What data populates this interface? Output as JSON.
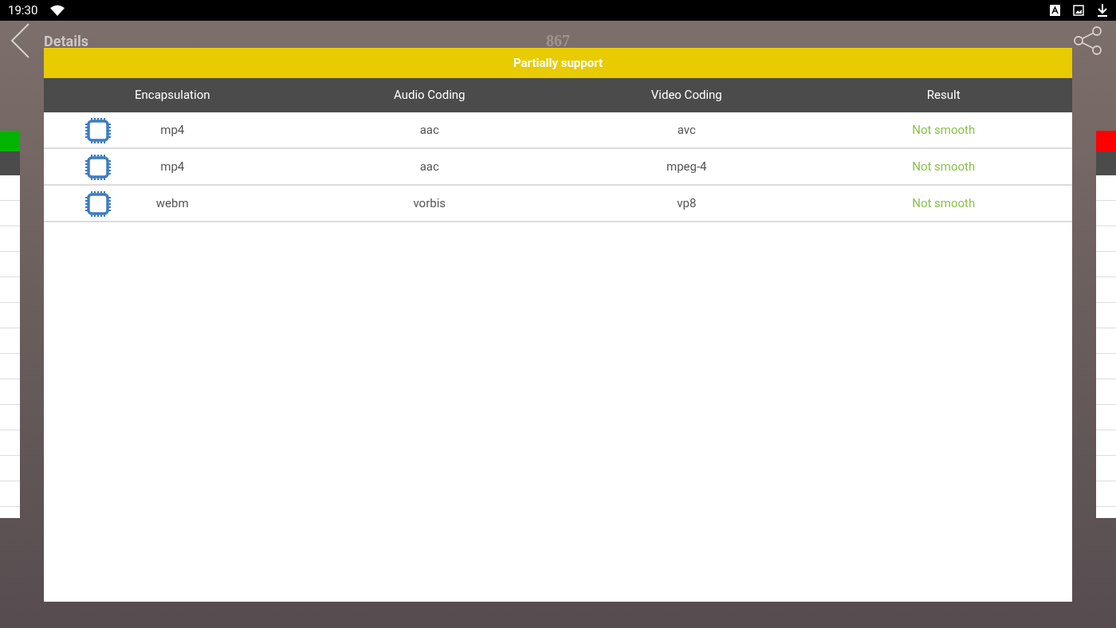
{
  "status_bar": {
    "time": "19:30"
  },
  "header": {
    "title": "Details",
    "count": "867"
  },
  "dialog": {
    "title": "Partially support",
    "columns": [
      "Encapsulation",
      "Audio Coding",
      "Video Coding",
      "Result"
    ],
    "rows": [
      {
        "encapsulation": "mp4",
        "audio": "aac",
        "video": "avc",
        "result": "Not smooth"
      },
      {
        "encapsulation": "mp4",
        "audio": "aac",
        "video": "mpeg-4",
        "result": "Not smooth"
      },
      {
        "encapsulation": "webm",
        "audio": "vorbis",
        "video": "vp8",
        "result": "Not smooth"
      }
    ]
  }
}
